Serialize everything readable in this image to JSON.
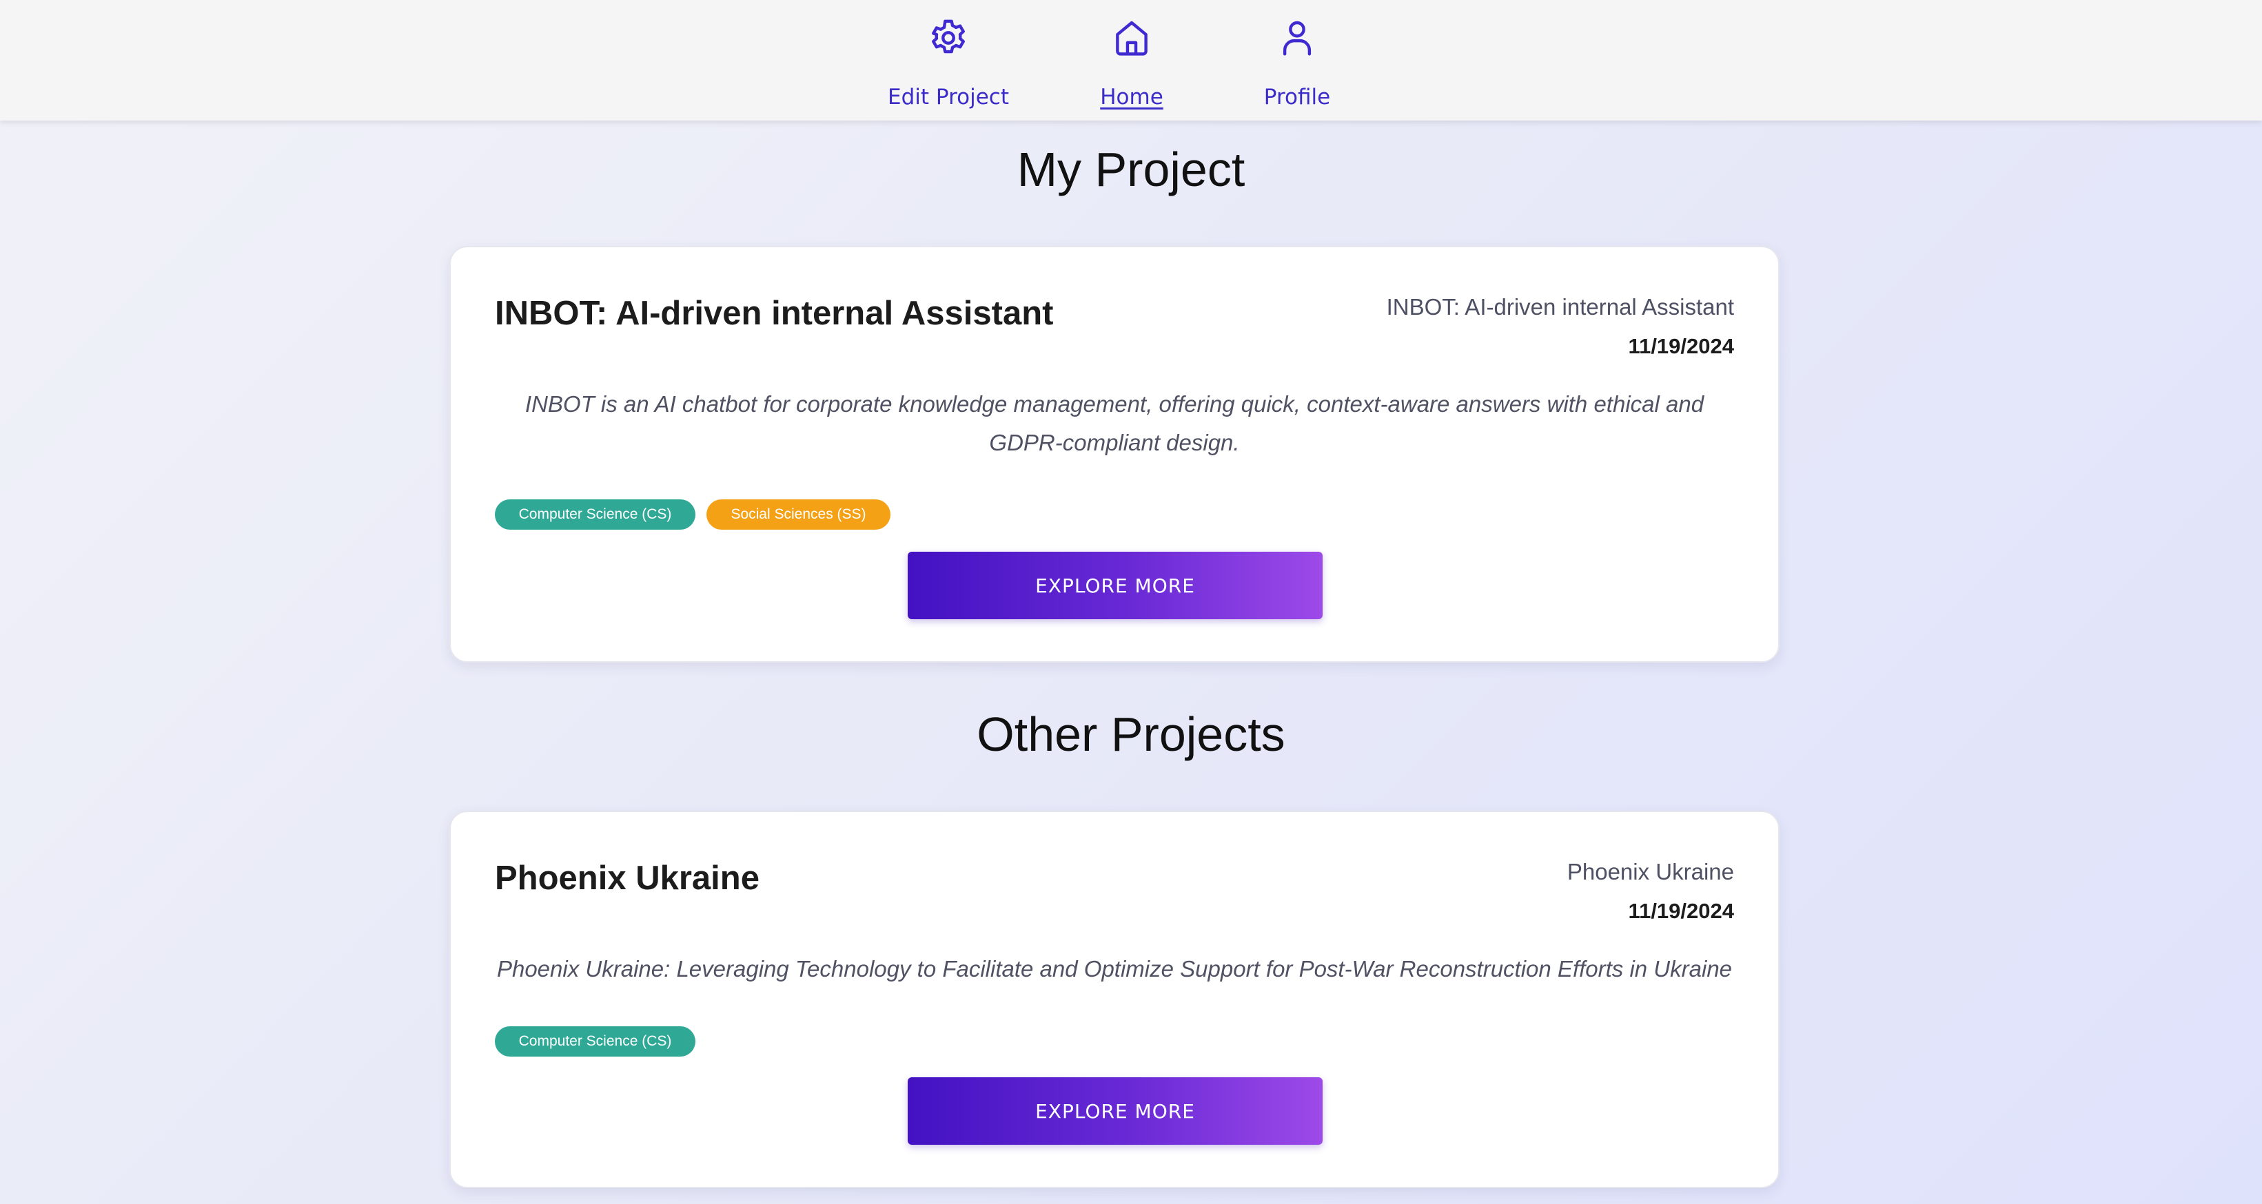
{
  "nav": {
    "items": [
      {
        "label": "Edit Project",
        "icon": "gear-icon"
      },
      {
        "label": "Home",
        "icon": "home-icon",
        "active": true
      },
      {
        "label": "Profile",
        "icon": "user-icon"
      }
    ],
    "accent_color": "#3f2ad2"
  },
  "my_project": {
    "heading": "My Project",
    "card": {
      "title": "INBOT: AI-driven internal Assistant",
      "meta_name": "INBOT: AI-driven internal Assistant",
      "date": "11/19/2024",
      "description": "INBOT is an AI chatbot for corporate knowledge management, offering quick, context-aware answers with ethical and GDPR-compliant design.",
      "tags": [
        {
          "label": "Computer Science (CS)",
          "color": "#2fa896"
        },
        {
          "label": "Social Sciences (SS)",
          "color": "#f4a116"
        }
      ],
      "button_label": "EXPLORE MORE"
    }
  },
  "other_projects": {
    "heading": "Other Projects",
    "cards": [
      {
        "title": "Phoenix Ukraine",
        "meta_name": "Phoenix Ukraine",
        "date": "11/19/2024",
        "description": "Phoenix Ukraine: Leveraging Technology to Facilitate and Optimize Support for Post-War Reconstruction Efforts in Ukraine",
        "tags": [
          {
            "label": "Computer Science (CS)",
            "color": "#2fa896"
          }
        ],
        "button_label": "EXPLORE MORE"
      }
    ]
  }
}
